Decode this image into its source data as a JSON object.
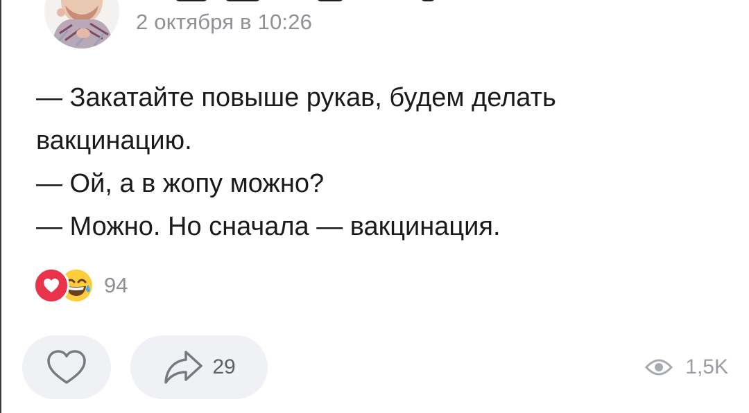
{
  "post": {
    "date": "2 октября в 10:26",
    "lines": [
      "— Закатайте повыше рукав, будем делать",
      "вакцинацию.",
      "— Ой, а в жопу можно?",
      "— Можно. Но сначала — вакцинация."
    ]
  },
  "reactions": {
    "count": "94",
    "icons": [
      "heart-reaction-icon",
      "laughing-with-tears-reaction-icon"
    ]
  },
  "actions": {
    "share_count": "29",
    "views_count": "1,5K"
  },
  "colors": {
    "secondary_text": "#8d9196",
    "pill_background": "#f0f1f4",
    "heart": "#e8334a",
    "laugh": "#ffcd3c"
  }
}
